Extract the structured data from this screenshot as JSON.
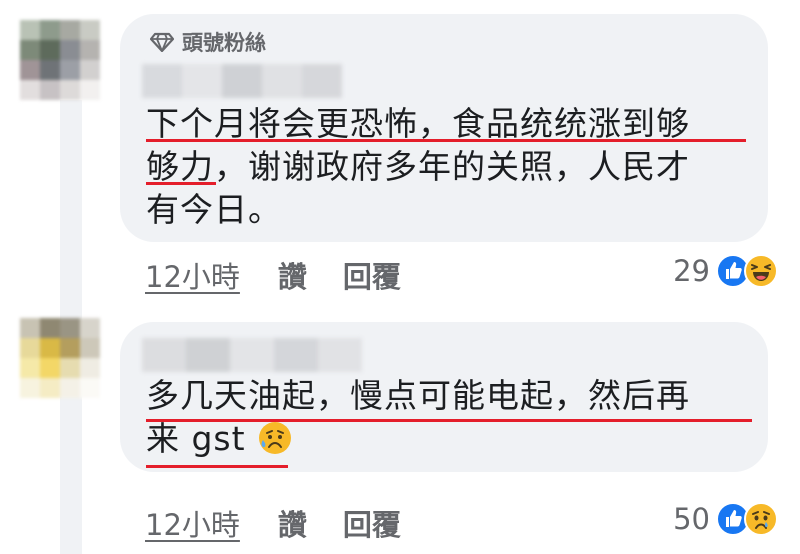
{
  "comments": [
    {
      "badge": "頭號粉絲",
      "text_line1": "下个月将会更恐怖，食品统统涨到够",
      "text_line2": "够力，谢谢政府多年的关照，人民才",
      "text_line3": "有今日。",
      "time": "12小時",
      "like_label": "讚",
      "reply_label": "回覆",
      "reaction_count": "29",
      "reaction_icons": [
        "like-icon",
        "haha-icon"
      ]
    },
    {
      "text_line1": "多几天油起，慢点可能电起，然后再",
      "text_line2": "来 gst",
      "text_emoji": "sad-sweat-emoji",
      "time": "12小時",
      "like_label": "讚",
      "reply_label": "回覆",
      "reaction_count": "50",
      "reaction_icons": [
        "like-icon",
        "sad-icon"
      ]
    }
  ],
  "colors": {
    "bubble": "#f0f2f5",
    "text": "#1c1e21",
    "meta": "#65676b",
    "underline": "#e41e2b",
    "like_blue": "#1877f2",
    "emoji_yellow": "#f7b928"
  }
}
